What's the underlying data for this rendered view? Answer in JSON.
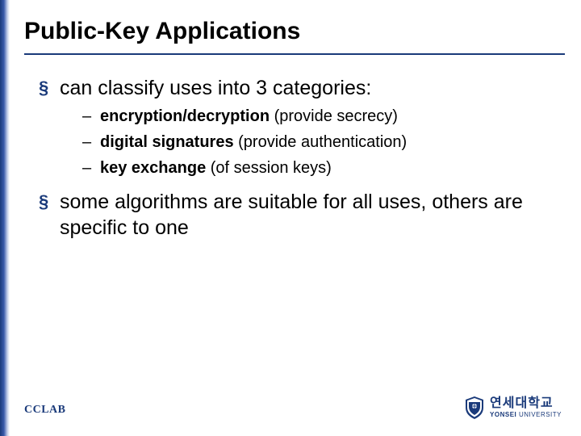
{
  "title": "Public-Key Applications",
  "bullets": [
    {
      "text": "can classify uses into 3 categories:",
      "subs": [
        {
          "bold": "encryption/decryption",
          "rest": " (provide secrecy)"
        },
        {
          "bold": "digital signatures",
          "rest": " (provide authentication)"
        },
        {
          "bold": "key exchange",
          "rest": " (of session keys)"
        }
      ]
    },
    {
      "text": "some algorithms are suitable for all uses, others are specific to one",
      "subs": []
    }
  ],
  "footer": {
    "left": "CCLAB",
    "uni_korean": "연세대학교",
    "uni_eng_bold": "YONSEI",
    "uni_eng_rest": " UNIVERSITY"
  }
}
